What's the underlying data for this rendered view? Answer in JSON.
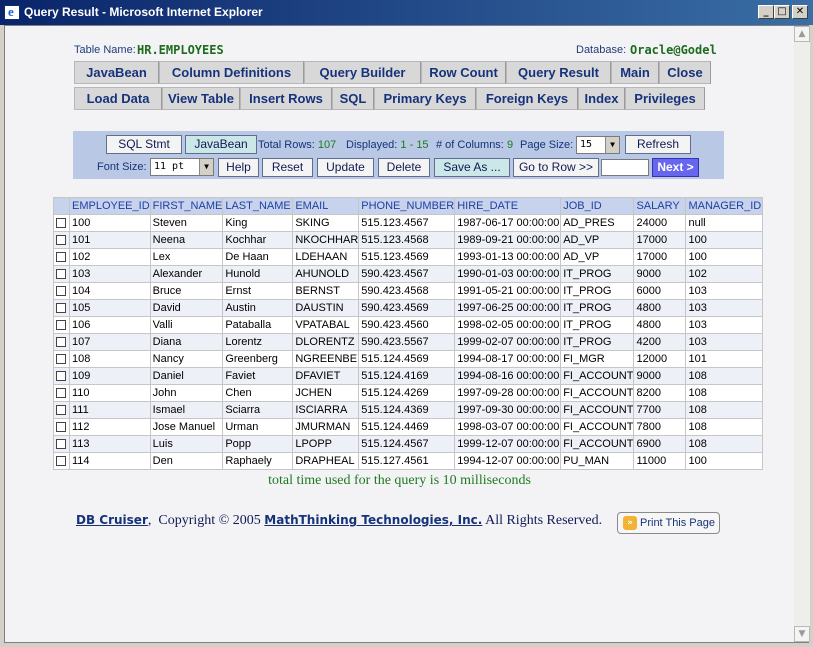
{
  "window": {
    "title": "Query Result - Microsoft Internet Explorer",
    "minimize_glyph": "_",
    "maximize_glyph": "□",
    "close_glyph": "✕"
  },
  "header": {
    "table_name_label": "Table Name:",
    "table_name": "HR.EMPLOYEES",
    "database_label": "Database:",
    "database": "Oracle@Godel"
  },
  "nav_row1": [
    "JavaBean",
    "Column Definitions",
    "Query Builder",
    "Row Count",
    "Query Result",
    "Main",
    "Close"
  ],
  "nav_row2": [
    "Load Data",
    "View Table",
    "Insert Rows",
    "SQL",
    "Primary Keys",
    "Foreign Keys",
    "Index",
    "Privileges"
  ],
  "controls": {
    "sql_stmt": "SQL Stmt",
    "javabean": "JavaBean",
    "total_rows_label": "Total Rows:",
    "total_rows": "107",
    "displayed_label": "Displayed:",
    "displayed": "1 - 15",
    "columns_label": "# of Columns:",
    "columns": "9",
    "page_size_label": "Page Size:",
    "page_size": "15",
    "refresh": "Refresh",
    "font_size_label": "Font Size:",
    "font_size": "11 pt",
    "help": "Help",
    "reset": "Reset",
    "update": "Update",
    "delete": "Delete",
    "save_as": "Save As ...",
    "go_to_row": "Go to Row >>",
    "go_to_value": "",
    "next": "Next >"
  },
  "table": {
    "columns": [
      "EMPLOYEE_ID",
      "FIRST_NAME",
      "LAST_NAME",
      "EMAIL",
      "PHONE_NUMBER",
      "HIRE_DATE",
      "JOB_ID",
      "SALARY",
      "MANAGER_ID"
    ],
    "rows": [
      [
        "100",
        "Steven",
        "King",
        "SKING",
        "515.123.4567",
        "1987-06-17 00:00:00",
        "AD_PRES",
        "24000",
        "null"
      ],
      [
        "101",
        "Neena",
        "Kochhar",
        "NKOCHHAR",
        "515.123.4568",
        "1989-09-21 00:00:00",
        "AD_VP",
        "17000",
        "100"
      ],
      [
        "102",
        "Lex",
        "De Haan",
        "LDEHAAN",
        "515.123.4569",
        "1993-01-13 00:00:00",
        "AD_VP",
        "17000",
        "100"
      ],
      [
        "103",
        "Alexander",
        "Hunold",
        "AHUNOLD",
        "590.423.4567",
        "1990-01-03 00:00:00",
        "IT_PROG",
        "9000",
        "102"
      ],
      [
        "104",
        "Bruce",
        "Ernst",
        "BERNST",
        "590.423.4568",
        "1991-05-21 00:00:00",
        "IT_PROG",
        "6000",
        "103"
      ],
      [
        "105",
        "David",
        "Austin",
        "DAUSTIN",
        "590.423.4569",
        "1997-06-25 00:00:00",
        "IT_PROG",
        "4800",
        "103"
      ],
      [
        "106",
        "Valli",
        "Pataballa",
        "VPATABAL",
        "590.423.4560",
        "1998-02-05 00:00:00",
        "IT_PROG",
        "4800",
        "103"
      ],
      [
        "107",
        "Diana",
        "Lorentz",
        "DLORENTZ",
        "590.423.5567",
        "1999-02-07 00:00:00",
        "IT_PROG",
        "4200",
        "103"
      ],
      [
        "108",
        "Nancy",
        "Greenberg",
        "NGREENBE",
        "515.124.4569",
        "1994-08-17 00:00:00",
        "FI_MGR",
        "12000",
        "101"
      ],
      [
        "109",
        "Daniel",
        "Faviet",
        "DFAVIET",
        "515.124.4169",
        "1994-08-16 00:00:00",
        "FI_ACCOUNT",
        "9000",
        "108"
      ],
      [
        "110",
        "John",
        "Chen",
        "JCHEN",
        "515.124.4269",
        "1997-09-28 00:00:00",
        "FI_ACCOUNT",
        "8200",
        "108"
      ],
      [
        "111",
        "Ismael",
        "Sciarra",
        "ISCIARRA",
        "515.124.4369",
        "1997-09-30 00:00:00",
        "FI_ACCOUNT",
        "7700",
        "108"
      ],
      [
        "112",
        "Jose Manuel",
        "Urman",
        "JMURMAN",
        "515.124.4469",
        "1998-03-07 00:00:00",
        "FI_ACCOUNT",
        "7800",
        "108"
      ],
      [
        "113",
        "Luis",
        "Popp",
        "LPOPP",
        "515.124.4567",
        "1999-12-07 00:00:00",
        "FI_ACCOUNT",
        "6900",
        "108"
      ],
      [
        "114",
        "Den",
        "Raphaely",
        "DRAPHEAL",
        "515.127.4561",
        "1994-12-07 00:00:00",
        "PU_MAN",
        "11000",
        "100"
      ]
    ]
  },
  "timing": "total time used for the query is 10 milliseconds",
  "footer": {
    "product": "DB Cruiser",
    "comma": ",",
    "copyright": "Copyright © 2005",
    "company": "MathThinking Technologies, Inc.",
    "rights": "All Rights Reserved.",
    "print_button": "Print This Page",
    "print_icon_glyph": "»"
  },
  "colors": {
    "title_bar": "#0a246a",
    "panel": "#b9c8e4",
    "header_row": "#c7d3ec",
    "accent_green": "#1e7a1e",
    "next_button": "#6666ee"
  }
}
